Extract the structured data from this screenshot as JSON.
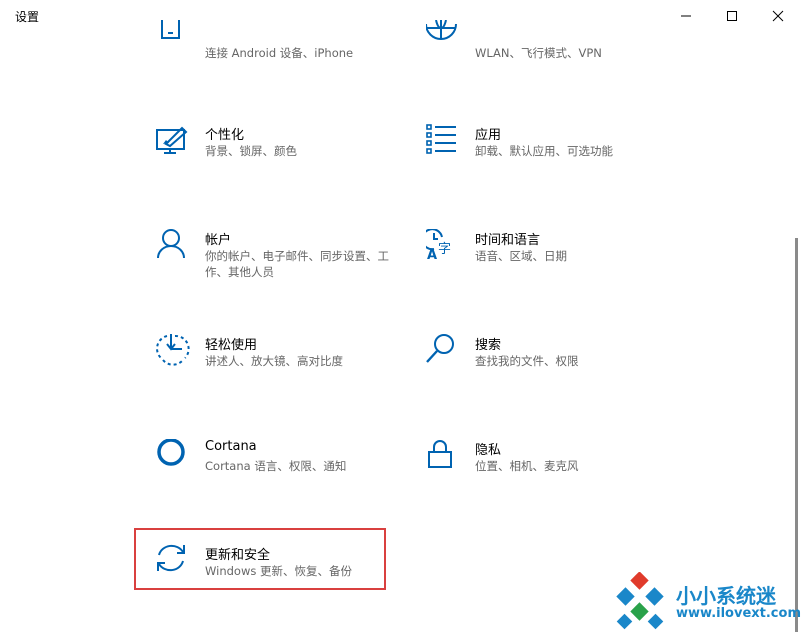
{
  "window": {
    "title": "设置"
  },
  "accent_color": "#0063b1",
  "highlight_color": "#d9403f",
  "tiles": [
    {
      "icon": "phone-icon",
      "name": "",
      "desc": "连接 Android 设备、iPhone"
    },
    {
      "icon": "globe-icon",
      "name": "",
      "desc": "WLAN、飞行模式、VPN"
    },
    {
      "icon": "personalization-icon",
      "name": "个性化",
      "desc": "背景、锁屏、颜色"
    },
    {
      "icon": "apps-icon",
      "name": "应用",
      "desc": "卸载、默认应用、可选功能"
    },
    {
      "icon": "account-icon",
      "name": "帐户",
      "desc": "你的帐户、电子邮件、同步设置、工作、其他人员"
    },
    {
      "icon": "time-language-icon",
      "name": "时间和语言",
      "desc": "语音、区域、日期"
    },
    {
      "icon": "ease-of-access-icon",
      "name": "轻松使用",
      "desc": "讲述人、放大镜、高对比度"
    },
    {
      "icon": "search-icon",
      "name": "搜索",
      "desc": "查找我的文件、权限"
    },
    {
      "icon": "cortana-icon",
      "name": "Cortana",
      "desc": "Cortana 语言、权限、通知"
    },
    {
      "icon": "lock-icon",
      "name": "隐私",
      "desc": "位置、相机、麦克风"
    },
    {
      "icon": "update-icon",
      "name": "更新和安全",
      "desc": "Windows 更新、恢复、备份"
    }
  ],
  "watermark": {
    "title": "小小系统迷",
    "url": "www.ilovext.com"
  }
}
